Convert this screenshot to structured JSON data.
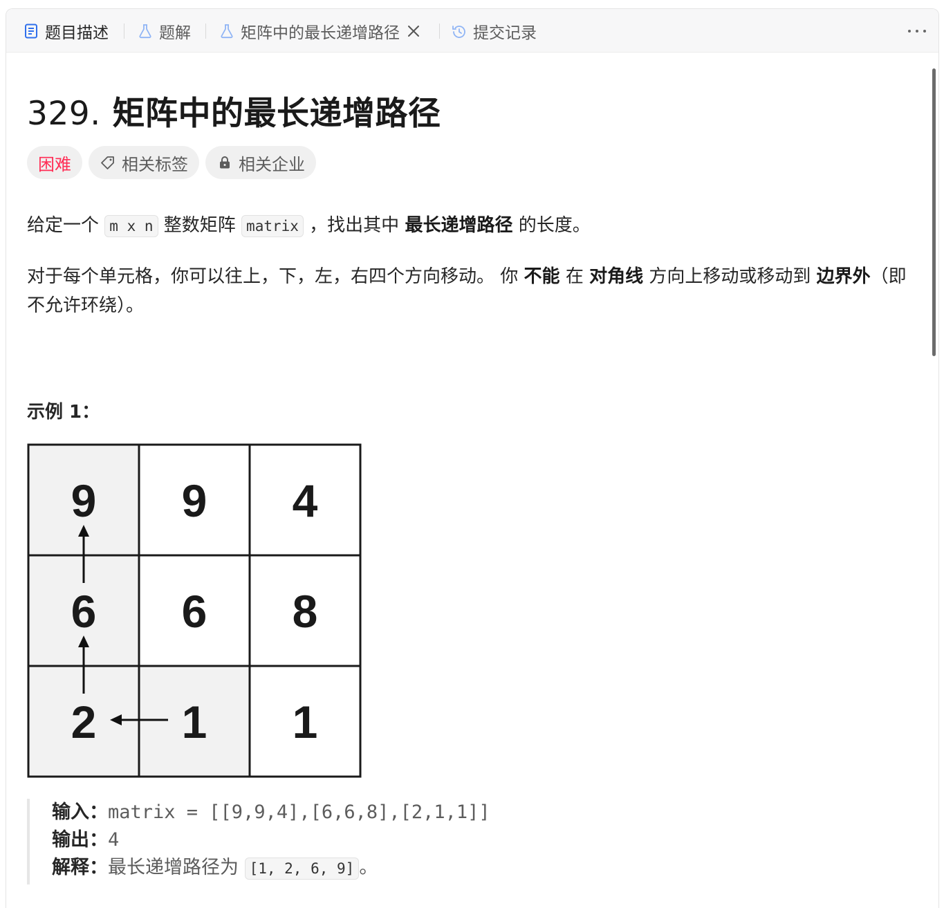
{
  "tabs": [
    {
      "label": "题目描述",
      "icon": "document-icon",
      "active": true
    },
    {
      "label": "题解",
      "icon": "flask-icon"
    },
    {
      "label": "矩阵中的最长递增路径",
      "icon": "flask-icon",
      "closable": true
    },
    {
      "label": "提交记录",
      "icon": "history-icon"
    }
  ],
  "problem": {
    "number": "329.",
    "title": "矩阵中的最长递增路径",
    "difficulty": "困难",
    "tags_label": "相关标签",
    "companies_label": "相关企业"
  },
  "description": {
    "p1_a": "给定一个",
    "p1_code1": "m x n",
    "p1_b": "整数矩阵",
    "p1_code2": "matrix",
    "p1_c": "，找出其中",
    "p1_bold": "最长递增路径",
    "p1_d": "的长度。",
    "p2_a": "对于每个单元格，你可以往上，下，左，右四个方向移动。 你",
    "p2_b1": "不能",
    "p2_c": "在",
    "p2_b2": "对角线",
    "p2_d": "方向上移动或移动到",
    "p2_b3": "边界外",
    "p2_e": "（即不允许环绕）。"
  },
  "example1": {
    "title": "示例 1：",
    "grid": [
      [
        9,
        9,
        4
      ],
      [
        6,
        6,
        8
      ],
      [
        2,
        1,
        1
      ]
    ],
    "input_label": "输入：",
    "input_value": "matrix = [[9,9,4],[6,6,8],[2,1,1]]",
    "output_label": "输出：",
    "output_value": "4",
    "explain_label": "解释：",
    "explain_text": "最长递增路径为",
    "explain_code": "[1, 2, 6, 9]",
    "explain_end": "。"
  },
  "colors": {
    "hard": "#ff2d55",
    "tab_icon_blue": "#2f6fec",
    "tab_icon_light": "#8fb4f5"
  }
}
